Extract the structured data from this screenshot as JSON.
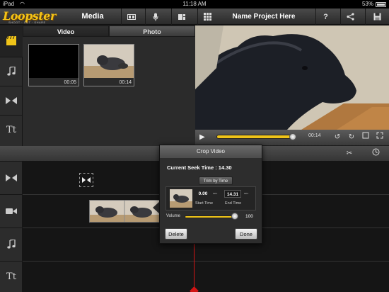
{
  "status_bar": {
    "carrier": "iPad",
    "time": "11:18 AM",
    "battery": "53%"
  },
  "toolbar": {
    "logo_text": "Loopster",
    "logo_tagline": "SHOOT · CUT · SHARE",
    "media_label": "Media",
    "project_name": "Name Project Here",
    "help_label": "?",
    "icons": [
      "movie-icon",
      "mic-icon",
      "storyboard-icon",
      "grid-icon",
      "help-icon",
      "share-icon",
      "save-icon"
    ]
  },
  "media": {
    "tabs": [
      {
        "label": "Video",
        "selected": true
      },
      {
        "label": "Photo",
        "selected": false
      }
    ],
    "clips": [
      {
        "duration": "00:05",
        "thumbnail": "black"
      },
      {
        "duration": "00:14",
        "thumbnail": "dog"
      }
    ]
  },
  "left_rail": {
    "icons": [
      "media-icon",
      "audio-icon",
      "transition-icon",
      "text-icon"
    ],
    "text_label": "Tt"
  },
  "preview": {
    "time": "00:14",
    "progress": 1.0
  },
  "timeline": {
    "track_icons": [
      "transition-icon",
      "video-camera-icon",
      "music-note-icon",
      "text-icon"
    ],
    "text_label": "Tt"
  },
  "crop_dialog": {
    "title": "Crop Video",
    "current_seek_label": "Current Seek Time : 14.30",
    "trim_button": "Trim by Time",
    "start_value": "0.00",
    "start_unit": "sec",
    "start_label": "Start Time",
    "end_value": "14.31",
    "end_unit": "sec",
    "end_label": "End Time",
    "volume_label": "Volume",
    "volume_value": "100",
    "volume_level": 1.0,
    "delete_label": "Delete",
    "done_label": "Done"
  }
}
